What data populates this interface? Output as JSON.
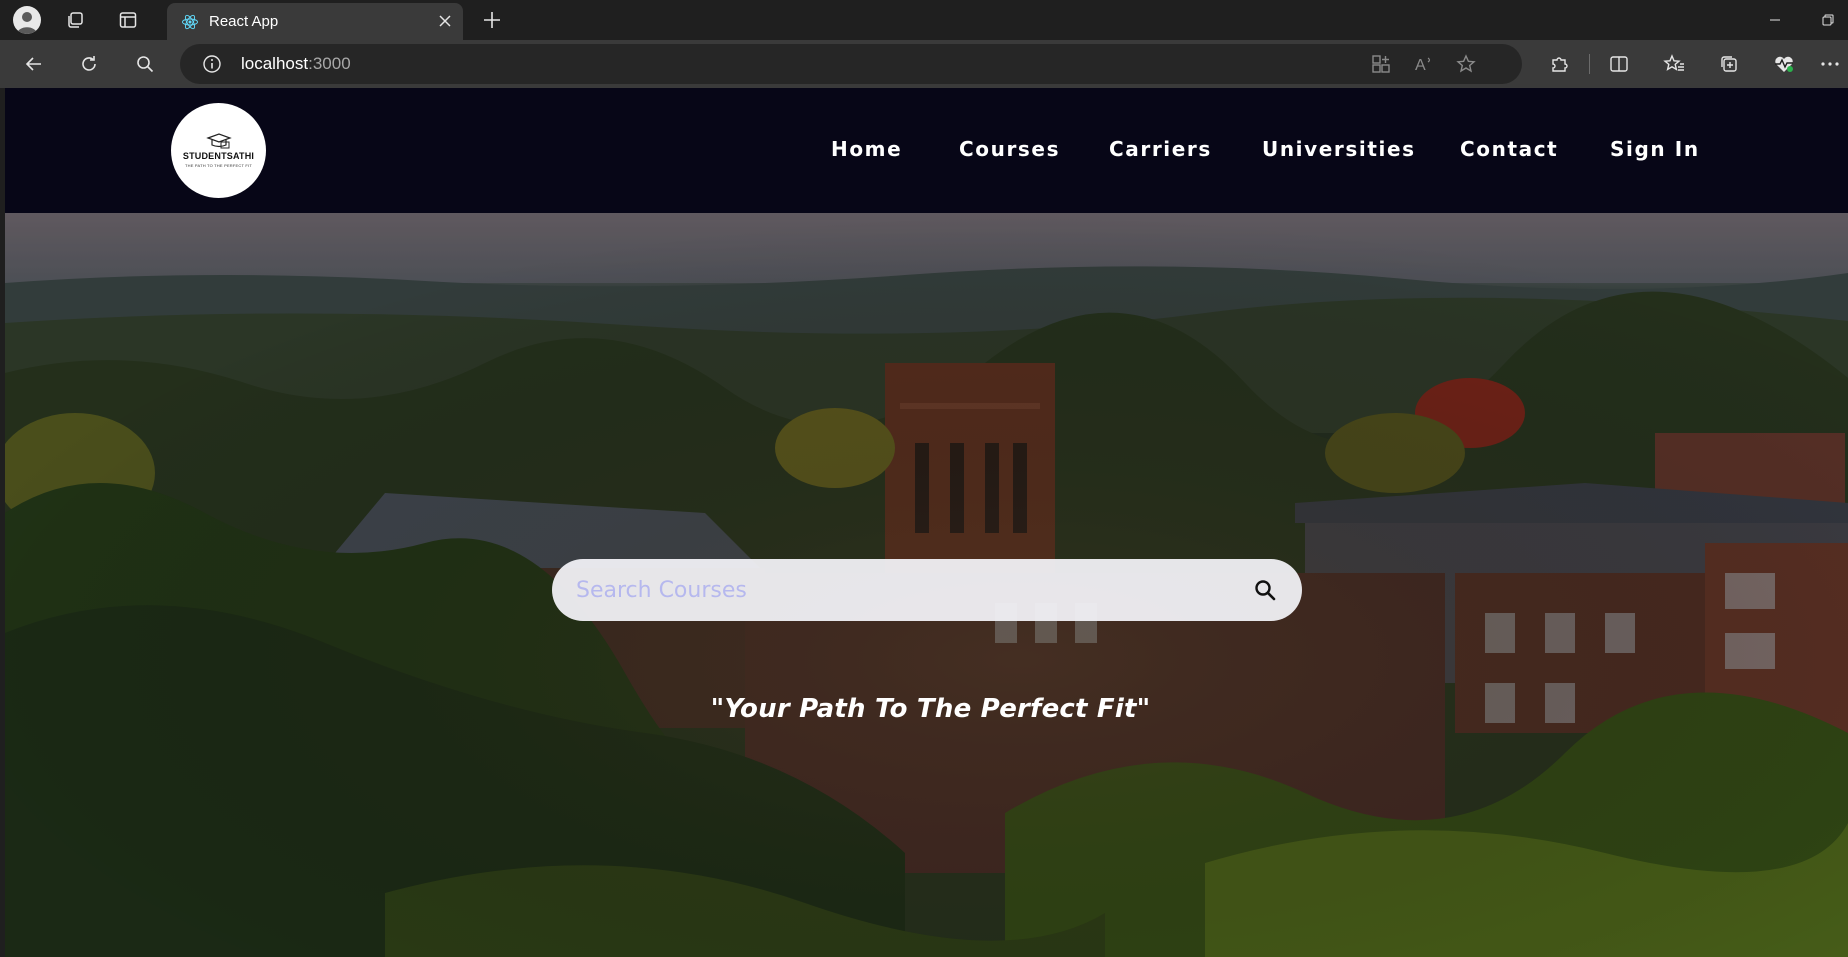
{
  "browser": {
    "tab": {
      "title": "React App"
    },
    "address": {
      "host": "localhost",
      "port": ":3000"
    },
    "icons": {
      "profile": "profile-icon",
      "workspaces": "workspaces-icon",
      "tab_actions": "vertical-tabs-icon",
      "favicon": "react-icon",
      "close": "close-icon",
      "new_tab": "plus-icon",
      "back": "back-arrow-icon",
      "reload": "reload-icon",
      "search": "search-icon",
      "site_info": "info-icon",
      "app_available": "app-install-icon",
      "read_aloud": "read-aloud-icon",
      "favorite": "star-icon",
      "extensions": "puzzle-icon",
      "split_screen": "split-screen-icon",
      "favorites": "favorites-icon",
      "collections": "collections-icon",
      "health": "heart-pulse-icon",
      "more": "ellipsis-icon"
    }
  },
  "site": {
    "logo": {
      "wordmark": "STUDENTSATHI",
      "tagline": "THE PATH TO THE PERFECT FIT"
    },
    "nav": [
      {
        "label": "Home"
      },
      {
        "label": "Courses"
      },
      {
        "label": "Carriers"
      },
      {
        "label": "Universities"
      },
      {
        "label": "Contact"
      },
      {
        "label": "Sign In"
      }
    ],
    "search": {
      "placeholder": "Search Courses",
      "value": ""
    },
    "tagline": "\"Your Path To The Perfect Fit\"",
    "colors": {
      "navbar_bg": "#070617",
      "search_bg": "#f2f2f6",
      "placeholder": "#b6b8ee",
      "text": "#ffffff"
    }
  }
}
